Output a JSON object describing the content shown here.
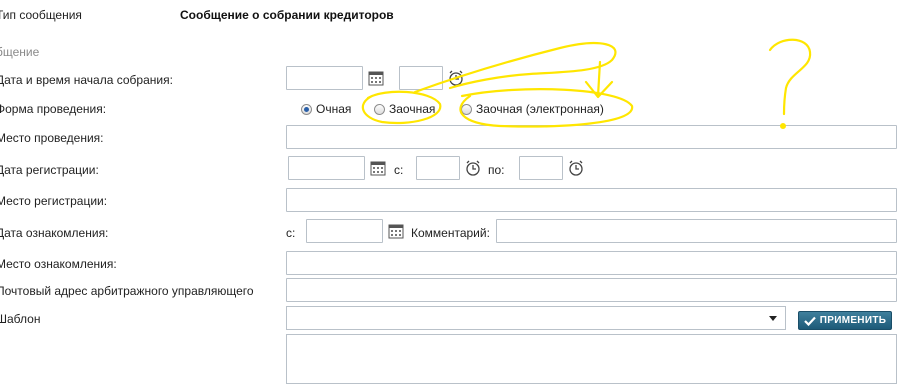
{
  "message_type": {
    "label": "Тип сообщения",
    "value": "Сообщение о собрании кредиторов"
  },
  "section_title": "бщение",
  "fields": {
    "meeting_start": {
      "label": "Дата и время начала собрания:"
    },
    "form": {
      "label": "Форма проведения:",
      "options": [
        "Очная",
        "Заочная",
        "Заочная (электронная)"
      ],
      "selected": "Очная"
    },
    "location": {
      "label": "Место проведения:"
    },
    "registration_date": {
      "label": "Дата регистрации:",
      "from_label": "с:",
      "to_label": "по:"
    },
    "registration_place": {
      "label": "Место регистрации:"
    },
    "familiarization_date": {
      "label": "Дата ознакомления:",
      "from_label": "с:",
      "comment_label": "Комментарий:"
    },
    "familiarization_place": {
      "label": "Место ознакомления:"
    },
    "manager_address": {
      "label": "Почтовый адрес арбитражного управляющего"
    },
    "template": {
      "label": "Шаблон",
      "apply_label": "ПРИМЕНИТЬ"
    }
  },
  "annotation": {
    "mark": "?",
    "color": "#ffe600"
  },
  "icons": {
    "calendar": "calendar-icon",
    "clock": "clock-icon",
    "check": "check-icon",
    "dropdown": "chevron-down-icon"
  }
}
